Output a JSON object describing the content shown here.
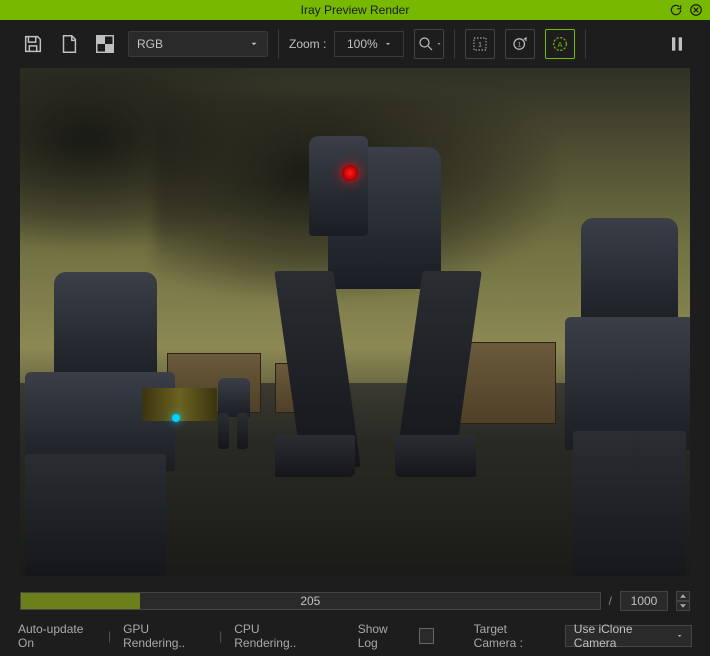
{
  "window": {
    "title": "Iray Preview Render"
  },
  "toolbar": {
    "channel": "RGB",
    "zoom_label": "Zoom :",
    "zoom_value": "100%"
  },
  "progress": {
    "current": "205",
    "total": "1000",
    "percent": 20.5
  },
  "status": {
    "auto_update": "Auto-update On",
    "gpu": "GPU Rendering..",
    "cpu": "CPU Rendering..",
    "show_log": "Show Log",
    "target_camera_label": "Target Camera :",
    "camera": "Use iClone Camera"
  }
}
